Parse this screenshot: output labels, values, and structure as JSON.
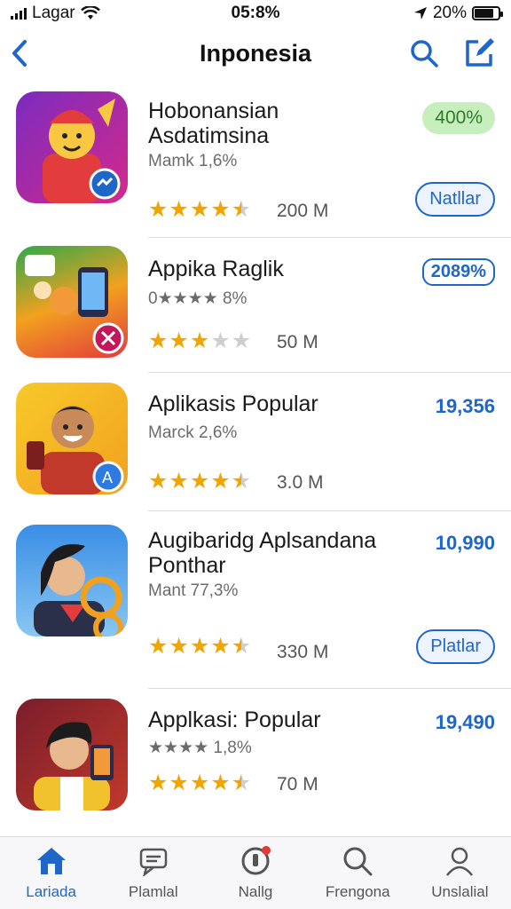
{
  "status": {
    "carrier": "Lagar",
    "time": "05:8%",
    "battery": "20%"
  },
  "header": {
    "title": "Inponesia"
  },
  "apps": [
    {
      "name_lines": [
        "Hobonansian",
        "Asdatimsina"
      ],
      "sub": "Mamk 1,6%",
      "rating": 4.5,
      "downloads": "200 M",
      "badge_top": "400%",
      "action": "Natllar",
      "colors": [
        "#7b2bbf",
        "#d42a8b"
      ]
    },
    {
      "name_lines": [
        "Appika Raglik"
      ],
      "sub": "0★★★★ 8%",
      "rating": 3,
      "downloads": "50 M",
      "badge_top": "2089%",
      "colors": [
        "#2ea84a",
        "#e23c3c"
      ]
    },
    {
      "name_lines": [
        "Aplikasis Popular"
      ],
      "sub": "Marck 2,6%",
      "rating": 4.5,
      "downloads": "3.0 M",
      "value": "19,356",
      "colors": [
        "#f7c92a",
        "#f2a11f"
      ]
    },
    {
      "name_lines": [
        "Augibaridg Aplsandana",
        "Ponthar"
      ],
      "sub": "Mant 77,3%",
      "rating": 4.5,
      "downloads": "330 M",
      "value": "10,990",
      "action": "Platlar",
      "colors": [
        "#3a8ee6",
        "#89c7f2"
      ]
    },
    {
      "name_lines": [
        "Applkasi: Popular"
      ],
      "sub": "★★★★ 1,8%",
      "rating": 4.5,
      "downloads": "70 M",
      "value": "19,490",
      "colors": [
        "#7a1d2b",
        "#c0392b"
      ]
    }
  ],
  "tabs": [
    {
      "label": "Lariada",
      "icon": "home-icon",
      "active": true
    },
    {
      "label": "Plamlal",
      "icon": "chat-icon",
      "active": false
    },
    {
      "label": "Nallg",
      "icon": "notification-icon",
      "active": false
    },
    {
      "label": "Frengona",
      "icon": "search-icon",
      "active": false
    },
    {
      "label": "Unslalial",
      "icon": "profile-icon",
      "active": false
    }
  ],
  "accent": "#1e66c8",
  "star_color": "#f0a500"
}
